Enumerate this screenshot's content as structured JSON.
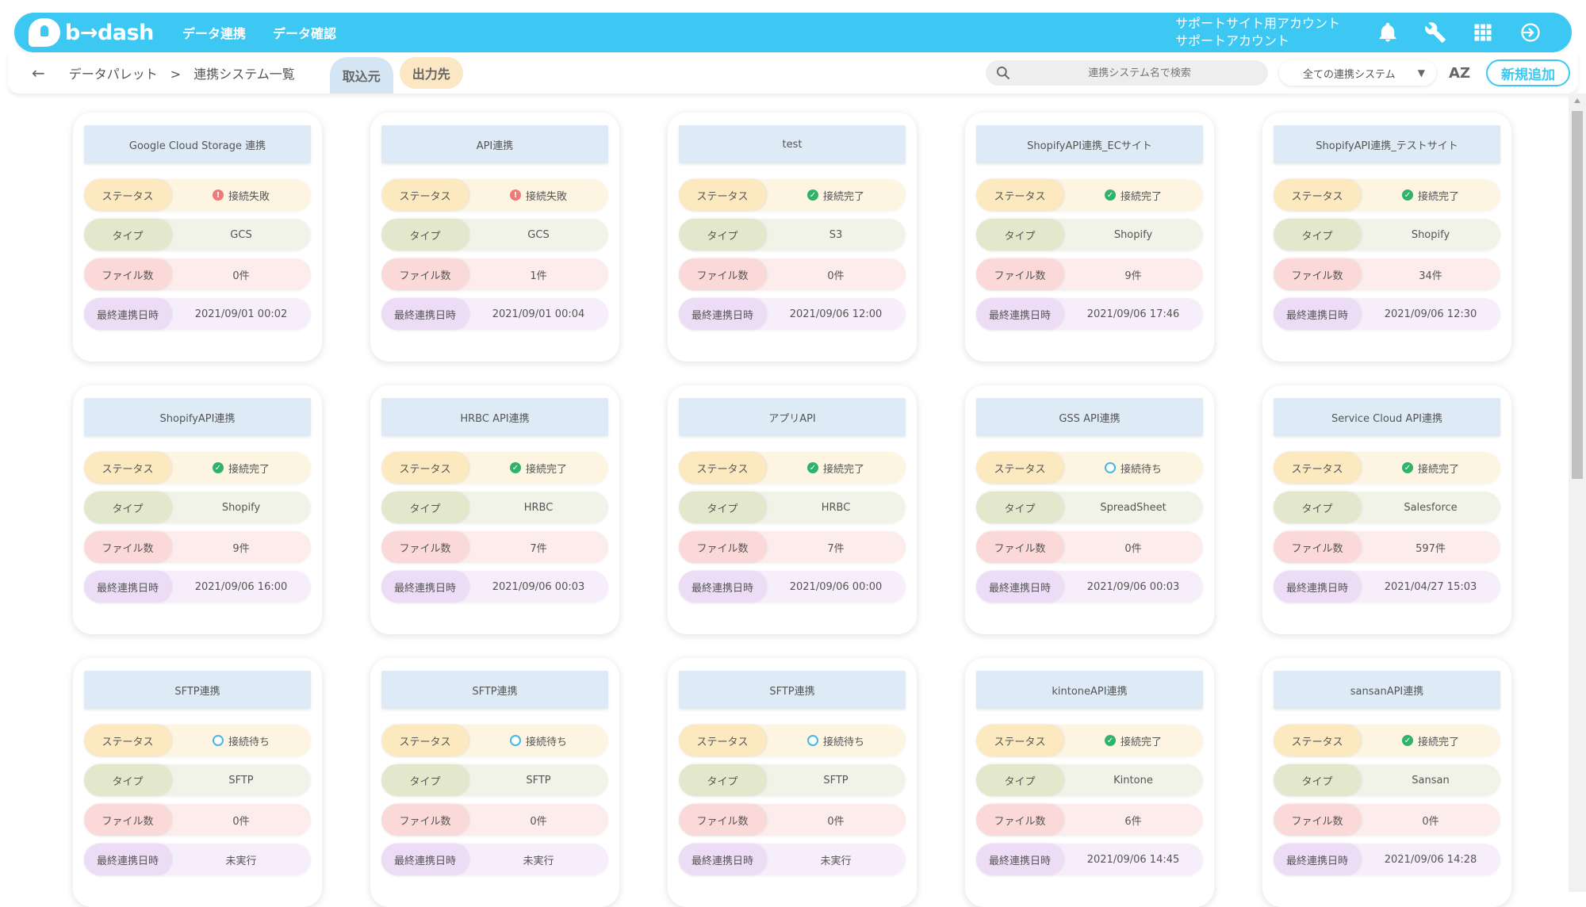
{
  "header": {
    "logo_text": "b→dash",
    "nav": [
      "データ連携",
      "データ確認"
    ],
    "account_line1": "サポートサイト用アカウント",
    "account_line2": "サポートアカウント"
  },
  "subbar": {
    "breadcrumb_root": "データパレット",
    "breadcrumb_sep": ">",
    "breadcrumb_current": "連携システム一覧",
    "tab_in": "取込元",
    "tab_out": "出力先",
    "search_placeholder": "連携システム名で検索",
    "filter_value": "全ての連携システム",
    "sort_label": "AZ",
    "new_button": "新規追加"
  },
  "labels": {
    "status": "ステータス",
    "type": "タイプ",
    "files": "ファイル数",
    "date": "最終連携日時"
  },
  "cards": [
    {
      "title": "Google Cloud Storage 連携",
      "status": "接続失敗",
      "status_kind": "fail",
      "type": "GCS",
      "files": "0件",
      "date": "2021/09/01 00:02"
    },
    {
      "title": "API連携",
      "status": "接続失敗",
      "status_kind": "fail",
      "type": "GCS",
      "files": "1件",
      "date": "2021/09/01 00:04"
    },
    {
      "title": "test",
      "status": "接続完了",
      "status_kind": "ok",
      "type": "S3",
      "files": "0件",
      "date": "2021/09/06 12:00"
    },
    {
      "title": "ShopifyAPI連携_ECサイト",
      "status": "接続完了",
      "status_kind": "ok",
      "type": "Shopify",
      "files": "9件",
      "date": "2021/09/06 17:46"
    },
    {
      "title": "ShopifyAPI連携_テストサイト",
      "status": "接続完了",
      "status_kind": "ok",
      "type": "Shopify",
      "files": "34件",
      "date": "2021/09/06 12:30"
    },
    {
      "title": "ShopifyAPI連携",
      "status": "接続完了",
      "status_kind": "ok",
      "type": "Shopify",
      "files": "9件",
      "date": "2021/09/06 16:00"
    },
    {
      "title": "HRBC API連携",
      "status": "接続完了",
      "status_kind": "ok",
      "type": "HRBC",
      "files": "7件",
      "date": "2021/09/06 00:03"
    },
    {
      "title": "アプリAPI",
      "status": "接続完了",
      "status_kind": "ok",
      "type": "HRBC",
      "files": "7件",
      "date": "2021/09/06 00:00"
    },
    {
      "title": "GSS API連携",
      "status": "接続待ち",
      "status_kind": "wait",
      "type": "SpreadSheet",
      "files": "0件",
      "date": "2021/09/06 00:03"
    },
    {
      "title": "Service Cloud API連携",
      "status": "接続完了",
      "status_kind": "ok",
      "type": "Salesforce",
      "files": "597件",
      "date": "2021/04/27 15:03"
    },
    {
      "title": "SFTP連携",
      "status": "接続待ち",
      "status_kind": "wait",
      "type": "SFTP",
      "files": "0件",
      "date": "未実行"
    },
    {
      "title": "SFTP連携",
      "status": "接続待ち",
      "status_kind": "wait",
      "type": "SFTP",
      "files": "0件",
      "date": "未実行"
    },
    {
      "title": "SFTP連携",
      "status": "接続待ち",
      "status_kind": "wait",
      "type": "SFTP",
      "files": "0件",
      "date": "未実行"
    },
    {
      "title": "kintoneAPI連携",
      "status": "接続完了",
      "status_kind": "ok",
      "type": "Kintone",
      "files": "6件",
      "date": "2021/09/06 14:45"
    },
    {
      "title": "sansanAPI連携",
      "status": "接続完了",
      "status_kind": "ok",
      "type": "Sansan",
      "files": "0件",
      "date": "2021/09/06 14:28"
    }
  ]
}
